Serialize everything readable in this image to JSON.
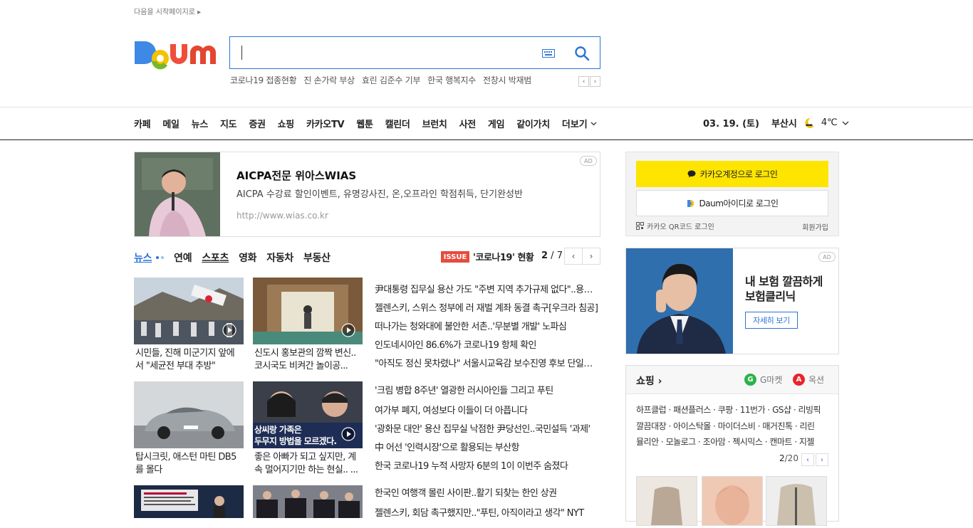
{
  "start_link": "다음을 시작페이지로",
  "logo_text": "Daum",
  "search": {
    "placeholder": "",
    "value": ""
  },
  "trending": [
    "코로나19 접종현황",
    "진 손가락 부상",
    "효린 김준수 기부",
    "한국 행복지수",
    "전창시 박재범"
  ],
  "nav": {
    "items": [
      "카페",
      "메일",
      "뉴스",
      "지도",
      "증권",
      "쇼핑",
      "카카오TV",
      "웹툰",
      "캘린더",
      "브런치",
      "사전",
      "게임",
      "같이가치"
    ],
    "more": "더보기",
    "date": "03. 19. (토)",
    "city": "부산시",
    "temperature": "4℃"
  },
  "top_ad": {
    "badge": "AD",
    "title": "AICPA전문 위아스WIAS",
    "description": "AICPA 수강료 할인이벤트, 유명강사진, 온,오프라인 학점취득, 단기완성반",
    "url": "http://www.wias.co.kr"
  },
  "news": {
    "tabs": [
      "뉴스",
      "연예",
      "스포츠",
      "영화",
      "자동차",
      "부동산"
    ],
    "issue_badge": "ISSUE",
    "issue_title": "'코로나19' 현황",
    "page_current": "2",
    "page_total": " / 7",
    "thumbs": [
      {
        "line1": "시민들, 진해 미군기지 앞에",
        "line2": "서 \"세균전 부대 추방\""
      },
      {
        "line1": "신도시 홍보관의 깜짝 변신..",
        "line2": "코시국도 비켜간 놀이공..."
      },
      {
        "line1": "탑시크릿, 애스턴 마틴 DB5",
        "line2": "를 몰다"
      },
      {
        "line1": "좋은 아빠가 되고 싶지만, 계",
        "line2": "속 멀어지기만 하는 현실.. ..."
      }
    ],
    "thumb_overlay": [
      "상씨랑 가족은",
      "두무지 방법을 모르겠다."
    ],
    "headlines": [
      "尹대통령 집무실 용산 가도 \"주변 지역 추가규제 없다\"..용산 개발",
      "젤렌스키, 스위스 정부에 러 재벌 계좌 동결 촉구[우크라 침공]",
      "떠나가는 청와대에 불안한 서촌..'무분별 개발' 노파심",
      "인도네시아인 86.6%가 코로나19 항체 확인",
      "\"아직도 정신 못차렸나\" 서울시교육감 보수진영 후보 단일화 난항",
      "'크림 병합 8주년' 열광한 러시아인들 그리고 푸틴",
      "여가부 폐지, 여성보다 이들이 더 아픕니다",
      "'광화문 대안' 용산 집무실 낙점한 尹당선인..국민설득 '과제'",
      "中 어선 '인력시장'으로 활용되는 부산항",
      "한국 코로나19 누적 사망자 6분의 1이 이번주 숨졌다",
      "한국인 여행객 몰린 사이판..활기 되찾는 한인 상권",
      "젤렌스키, 회담 촉구했지만..\"푸틴, 아직이라고 생각\" NYT"
    ]
  },
  "login": {
    "kakao_button": "카카오계정으로 로그인",
    "daum_button": "Daum아이디로 로그인",
    "qr_login": "카카오 QR코드 로그인",
    "signup": "회원가입"
  },
  "side_ad": {
    "badge": "AD",
    "title": "내 보험 깔끔하게 보험클리닉",
    "button": "자세히 보기"
  },
  "shopping": {
    "title": "쇼핑",
    "gmarket": "G마켓",
    "auction": "옥션",
    "lines": [
      "하프클럽 · 패션플러스 · 쿠팡 · 11번가 · GS샵 · 리빙픽",
      "깔끔대장 · 아이스탁몰 · 마이더스비 · 매거진톡 · 리린",
      "뮬리안 · 모놀로그 · 조아맘 · 젝시믹스 · 캔마트 · 지젤"
    ],
    "page_current": "2",
    "page_total": "/20"
  },
  "colors": {
    "accent": "#2a74d8",
    "kakao": "#fee500",
    "issue": "#e64b3c"
  }
}
